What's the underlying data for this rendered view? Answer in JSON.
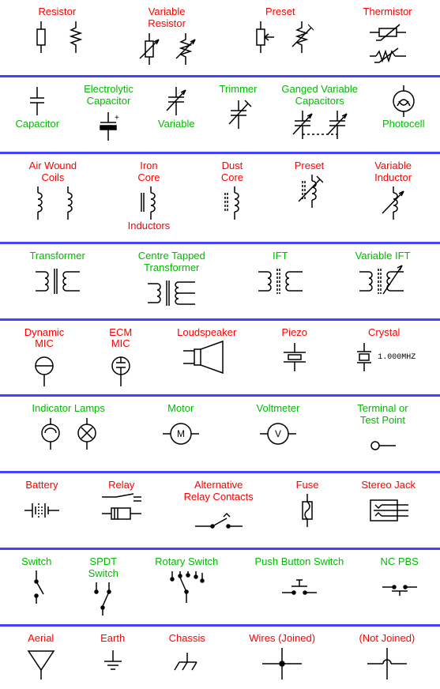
{
  "colors": {
    "label_a": "#ff0000",
    "label_b": "#00bb00",
    "divider": "#4444ff",
    "stroke": "#000000"
  },
  "crystal_note": "1.000MHZ",
  "rows": [
    {
      "color": "red",
      "items": [
        {
          "name": "resistor",
          "label": "Resistor"
        },
        {
          "name": "variable-resistor",
          "label": "Variable\nResistor"
        },
        {
          "name": "preset",
          "label": "Preset"
        },
        {
          "name": "thermistor",
          "label": "Thermistor"
        }
      ]
    },
    {
      "color": "grn",
      "items": [
        {
          "name": "capacitor",
          "label": "Capacitor"
        },
        {
          "name": "electrolytic-capacitor",
          "label": "Electrolytic\nCapacitor"
        },
        {
          "name": "variable-capacitor",
          "label": "Variable"
        },
        {
          "name": "trimmer-capacitor",
          "label": "Trimmer"
        },
        {
          "name": "ganged-variable-capacitors",
          "label": "Ganged Variable\nCapacitors"
        },
        {
          "name": "photocell",
          "label": "Photocell"
        }
      ]
    },
    {
      "color": "red",
      "items": [
        {
          "name": "air-wound-coils",
          "label": "Air Wound\nCoils"
        },
        {
          "name": "iron-core-inductor",
          "label": "Iron\nCore"
        },
        {
          "name": "dust-core-inductor",
          "label": "Dust\nCore"
        },
        {
          "name": "inductors-group-label",
          "label": "Inductors"
        },
        {
          "name": "preset-inductor",
          "label": "Preset"
        },
        {
          "name": "variable-inductor",
          "label": "Variable\nInductor"
        }
      ]
    },
    {
      "color": "grn",
      "items": [
        {
          "name": "transformer",
          "label": "Transformer"
        },
        {
          "name": "centre-tapped-transformer",
          "label": "Centre Tapped\nTransformer"
        },
        {
          "name": "ift",
          "label": "IFT"
        },
        {
          "name": "variable-ift",
          "label": "Variable IFT"
        }
      ]
    },
    {
      "color": "red",
      "items": [
        {
          "name": "dynamic-mic",
          "label": "Dynamic\nMIC"
        },
        {
          "name": "ecm-mic",
          "label": "ECM\nMIC"
        },
        {
          "name": "loudspeaker",
          "label": "Loudspeaker"
        },
        {
          "name": "piezo",
          "label": "Piezo"
        },
        {
          "name": "crystal",
          "label": "Crystal"
        }
      ]
    },
    {
      "color": "grn",
      "items": [
        {
          "name": "indicator-lamps",
          "label": "Indicator Lamps"
        },
        {
          "name": "motor",
          "label": "Motor"
        },
        {
          "name": "voltmeter",
          "label": "Voltmeter"
        },
        {
          "name": "terminal-test-point",
          "label": "Terminal or\nTest Point"
        }
      ]
    },
    {
      "color": "red",
      "items": [
        {
          "name": "battery",
          "label": "Battery"
        },
        {
          "name": "relay",
          "label": "Relay"
        },
        {
          "name": "alternative-relay-contacts",
          "label": "Alternative\nRelay Contacts"
        },
        {
          "name": "fuse",
          "label": "Fuse"
        },
        {
          "name": "stereo-jack",
          "label": "Stereo Jack"
        }
      ]
    },
    {
      "color": "grn",
      "items": [
        {
          "name": "switch",
          "label": "Switch"
        },
        {
          "name": "spdt-switch",
          "label": "SPDT\nSwitch"
        },
        {
          "name": "rotary-switch",
          "label": "Rotary Switch"
        },
        {
          "name": "push-button-switch",
          "label": "Push Button Switch"
        },
        {
          "name": "nc-pbs",
          "label": "NC PBS"
        }
      ]
    },
    {
      "color": "red",
      "items": [
        {
          "name": "aerial",
          "label": "Aerial"
        },
        {
          "name": "earth",
          "label": "Earth"
        },
        {
          "name": "chassis",
          "label": "Chassis"
        },
        {
          "name": "wires-joined",
          "label": "Wires (Joined)"
        },
        {
          "name": "wires-not-joined",
          "label": "(Not Joined)"
        }
      ]
    }
  ]
}
